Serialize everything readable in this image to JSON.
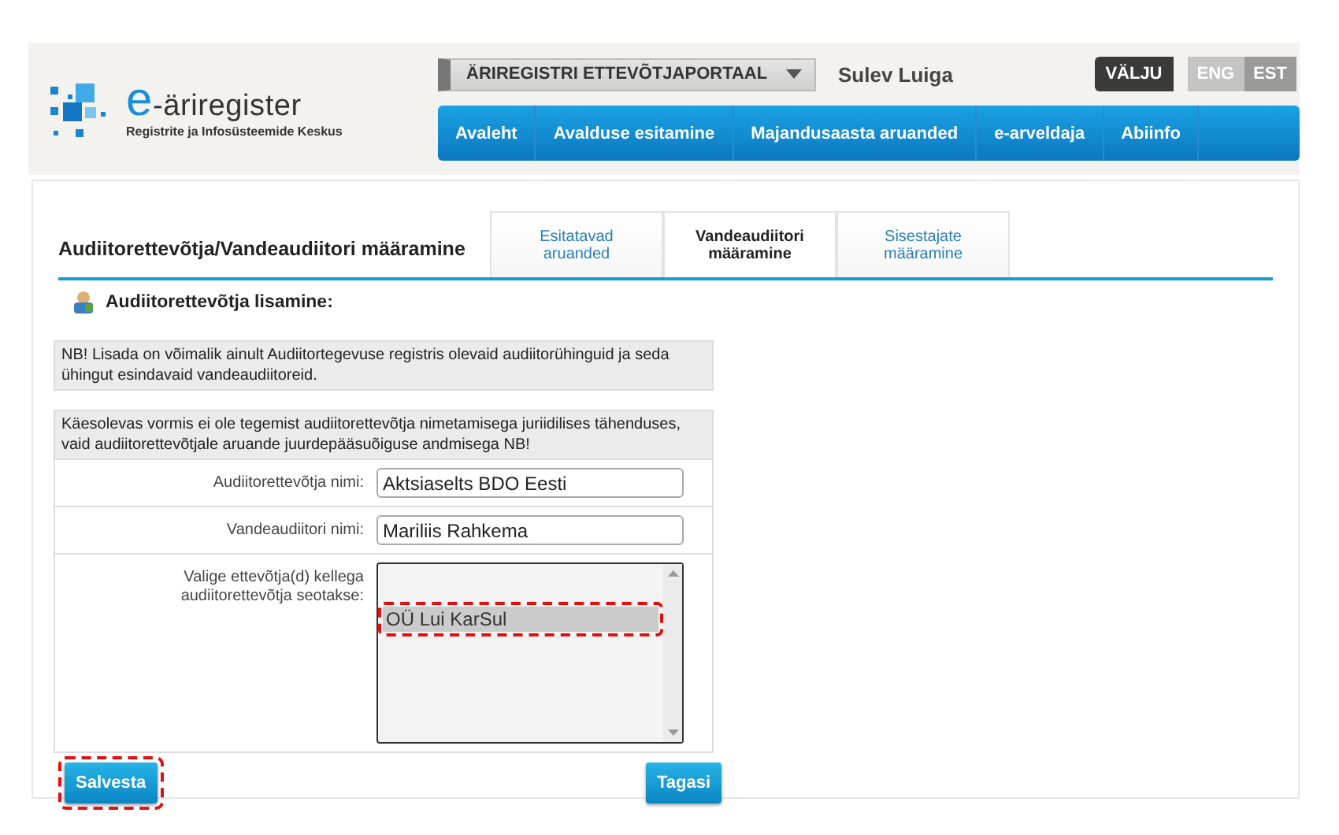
{
  "header": {
    "logo_title": "e-äriregister",
    "logo_subtitle": "Registrite ja Infosüsteemide Keskus",
    "portal_select": "ÄRIREGISTRI ETTEVÕTJAPORTAAL",
    "user_name": "Sulev Luiga",
    "logout": "VÄLJU",
    "languages": [
      {
        "label": "ENG",
        "selected": false
      },
      {
        "label": "EST",
        "selected": true
      }
    ]
  },
  "nav": [
    "Avaleht",
    "Avalduse esitamine",
    "Majandusaasta aruanded",
    "e-arveldaja",
    "Abiinfo"
  ],
  "page_title": "Audiitorettevõtja/Vandeaudiitori määramine",
  "tabs": [
    {
      "label": "Esitatavad aruanded",
      "selected": false
    },
    {
      "label": "Vandeaudiitori määramine",
      "selected": true
    },
    {
      "label": "Sisestajate määramine",
      "selected": false
    }
  ],
  "section_title": "Audiitorettevõtja lisamine:",
  "notice": "NB! Lisada on võimalik ainult Audiitortegevuse registris olevaid audiitorühinguid ja seda ühingut esindavaid vandeaudiitoreid.",
  "form": {
    "intro": "Käesolevas vormis ei ole tegemist audiitorettevõtja nimetamisega juriidilises tähenduses, vaid audiitorettevõtjale aruande juurdepääsuõiguse andmisega NB!",
    "fields": [
      {
        "kind": "text",
        "label": "Audiitorettevõtja nimi:",
        "value": "Aktsiaselts BDO Eesti"
      },
      {
        "kind": "text",
        "label": "Vandeaudiitori nimi:",
        "value": "Mariliis Rahkema"
      },
      {
        "kind": "listbox",
        "label": "Valige ettevõtja(d) kellega audiitorettevõtja seotakse:",
        "options": [
          {
            "label": "OÜ Lui KarSul",
            "selected": true,
            "highlighted": true
          }
        ]
      }
    ]
  },
  "buttons": [
    {
      "kind": "save",
      "label": "Salvesta",
      "highlighted": true
    },
    {
      "kind": "back",
      "label": "Tagasi",
      "highlighted": false
    }
  ]
}
